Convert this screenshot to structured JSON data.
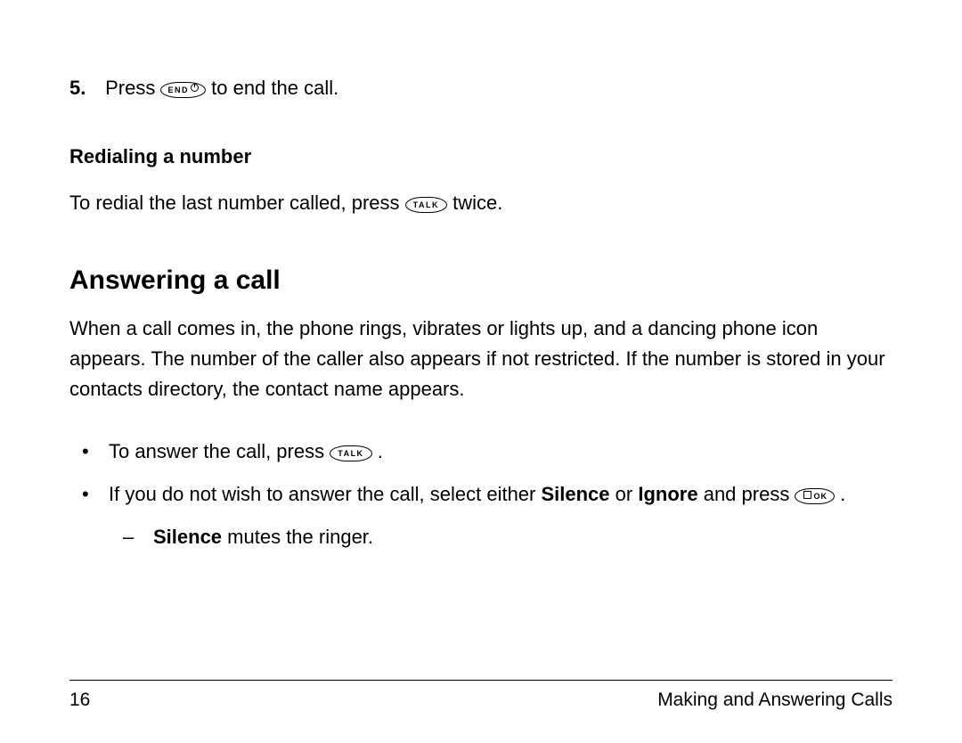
{
  "step": {
    "num": "5.",
    "pre": "Press ",
    "key": "END",
    "post": " to end the call."
  },
  "redial": {
    "heading": "Redialing a number",
    "pre": "To redial the last number called, press ",
    "key": "TALK",
    "post": " twice."
  },
  "answer": {
    "heading": "Answering a call",
    "body": "When a call comes in, the phone rings, vibrates or lights up, and a dancing phone icon appears. The number of the caller also appears if not restricted. If the number is stored in your contacts directory, the contact name appears.",
    "b1": {
      "pre": "To answer the call, press ",
      "key": "TALK",
      "post": "."
    },
    "b2": {
      "pre": "If you do not wish to answer the call, select either ",
      "opt1": "Silence",
      "mid": " or ",
      "opt2": "Ignore",
      "and": " and press ",
      "key": "OK",
      "post": "."
    },
    "sub": {
      "bold": "Silence",
      "rest": " mutes the ringer."
    }
  },
  "footer": {
    "page": "16",
    "section": "Making and Answering Calls"
  }
}
